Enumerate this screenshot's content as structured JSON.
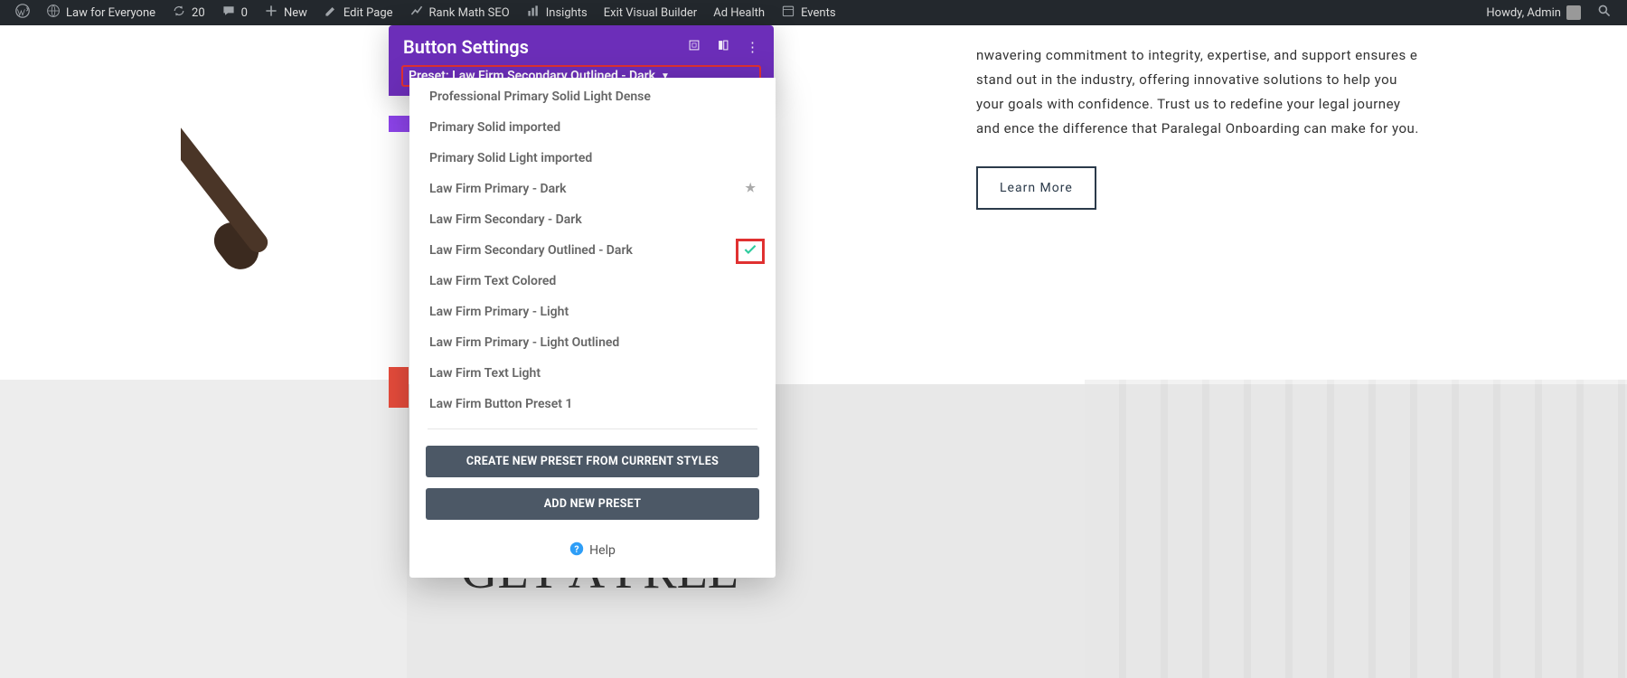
{
  "admin_bar": {
    "site_name": "Law for Everyone",
    "updates_count": "20",
    "comments_count": "0",
    "new": "New",
    "edit_page": "Edit Page",
    "rank_math": "Rank Math SEO",
    "insights": "Insights",
    "exit_vb": "Exit Visual Builder",
    "ad_health": "Ad Health",
    "events": "Events",
    "howdy": "Howdy, Admin"
  },
  "modal": {
    "title": "Button Settings",
    "preset_label": "Preset: Law Firm Secondary Outlined - Dark",
    "presets": [
      "Professional Primary Solid Light Dense",
      "Primary Solid imported",
      "Primary Solid Light imported",
      "Law Firm Primary - Dark",
      "Law Firm Secondary - Dark",
      "Law Firm Secondary Outlined - Dark",
      "Law Firm Text Colored",
      "Law Firm Primary - Light",
      "Law Firm Primary - Light Outlined",
      "Law Firm Text Light",
      "Law Firm Button Preset 1"
    ],
    "starred_index": 3,
    "selected_index": 5,
    "create_btn": "CREATE NEW PRESET FROM CURRENT STYLES",
    "add_btn": "ADD NEW PRESET",
    "help": "Help"
  },
  "page": {
    "paragraph": "nwavering commitment to integrity, expertise, and support ensures e stand out in the industry, offering innovative solutions to help you your goals with confidence. Trust us to redefine your legal journey and ence the difference that Paralegal Onboarding can make for you.",
    "learn_more": "Learn More",
    "cta_heading": "GET A FREE"
  }
}
